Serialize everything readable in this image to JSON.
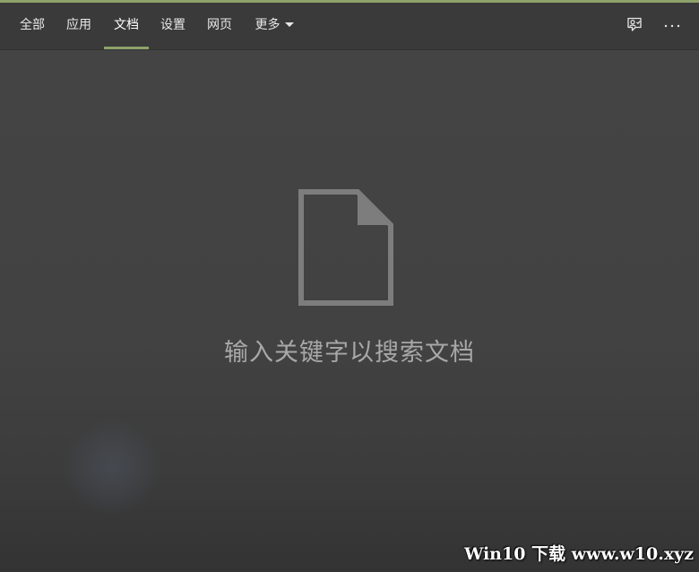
{
  "tabs": [
    {
      "label": "全部",
      "active": false
    },
    {
      "label": "应用",
      "active": false
    },
    {
      "label": "文档",
      "active": true
    },
    {
      "label": "设置",
      "active": false
    },
    {
      "label": "网页",
      "active": false
    },
    {
      "label": "更多",
      "active": false,
      "has_dropdown": true
    }
  ],
  "toolbar": {
    "feedback_icon": "feedback-icon",
    "more_options_icon": "more-options-icon"
  },
  "empty_state": {
    "icon": "document-icon",
    "message": "输入关键字以搜索文档"
  },
  "watermark": {
    "text": "Win10 下载 www.w10.xyz"
  },
  "colors": {
    "accent": "#8ea26a",
    "background": "#414141",
    "tabbar": "#3a3a3a",
    "message_text": "#a8a8a8"
  }
}
